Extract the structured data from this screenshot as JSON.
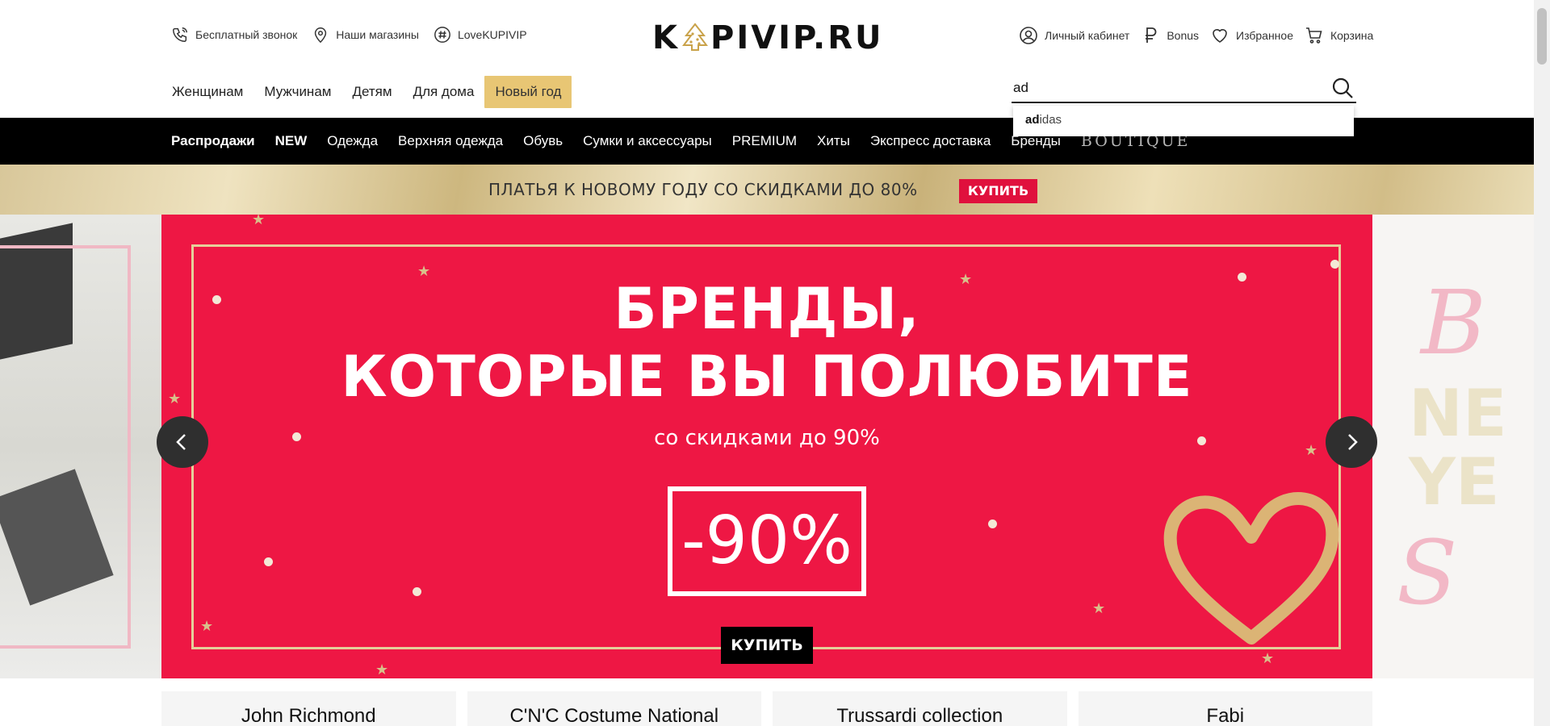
{
  "header": {
    "util_left": [
      {
        "label": "Бесплатный звонок",
        "icon": "phone-icon"
      },
      {
        "label": "Наши магазины",
        "icon": "location-pin-icon"
      },
      {
        "label": "LoveKUPIVIP",
        "icon": "hashtag-icon"
      }
    ],
    "logo_left": "K",
    "logo_right": "PIVIP.RU",
    "util_right": [
      {
        "label": "Личный кабинет",
        "icon": "user-icon"
      },
      {
        "label": "Bonus",
        "icon": "ruble-icon"
      },
      {
        "label": "Избранное",
        "icon": "heart-icon"
      },
      {
        "label": "Корзина",
        "icon": "cart-icon"
      }
    ]
  },
  "categories": [
    "Женщинам",
    "Мужчинам",
    "Детям",
    "Для дома",
    "Новый год"
  ],
  "search": {
    "value": "ad",
    "suggestion_match": "ad",
    "suggestion_rest": "idas"
  },
  "menu": [
    "Распродажи",
    "NEW",
    "Одежда",
    "Верхняя одежда",
    "Обувь",
    "Сумки и аксессуары",
    "PREMIUM",
    "Хиты",
    "Экспресс доставка",
    "Бренды",
    "BOUTIQUE"
  ],
  "promo": {
    "text": "ПЛАТЬЯ К НОВОМУ ГОДУ СО СКИДКАМИ ДО 80%",
    "button": "КУПИТЬ"
  },
  "slide": {
    "title_line1": "БРЕНДЫ,",
    "title_line2": "КОТОРЫЕ ВЫ ПОЛЮБИТЕ",
    "subtitle": "со скидками до 90%",
    "discount": "-90%",
    "button": "КУПИТЬ"
  },
  "brands": [
    "John Richmond",
    "C'N'C Costume National",
    "Trussardi collection",
    "Fabi"
  ],
  "colors": {
    "accent_red": "#ee1744",
    "promo_button": "#e0103d",
    "new_year_tab": "#e8c674",
    "menu_bar": "#000000"
  }
}
